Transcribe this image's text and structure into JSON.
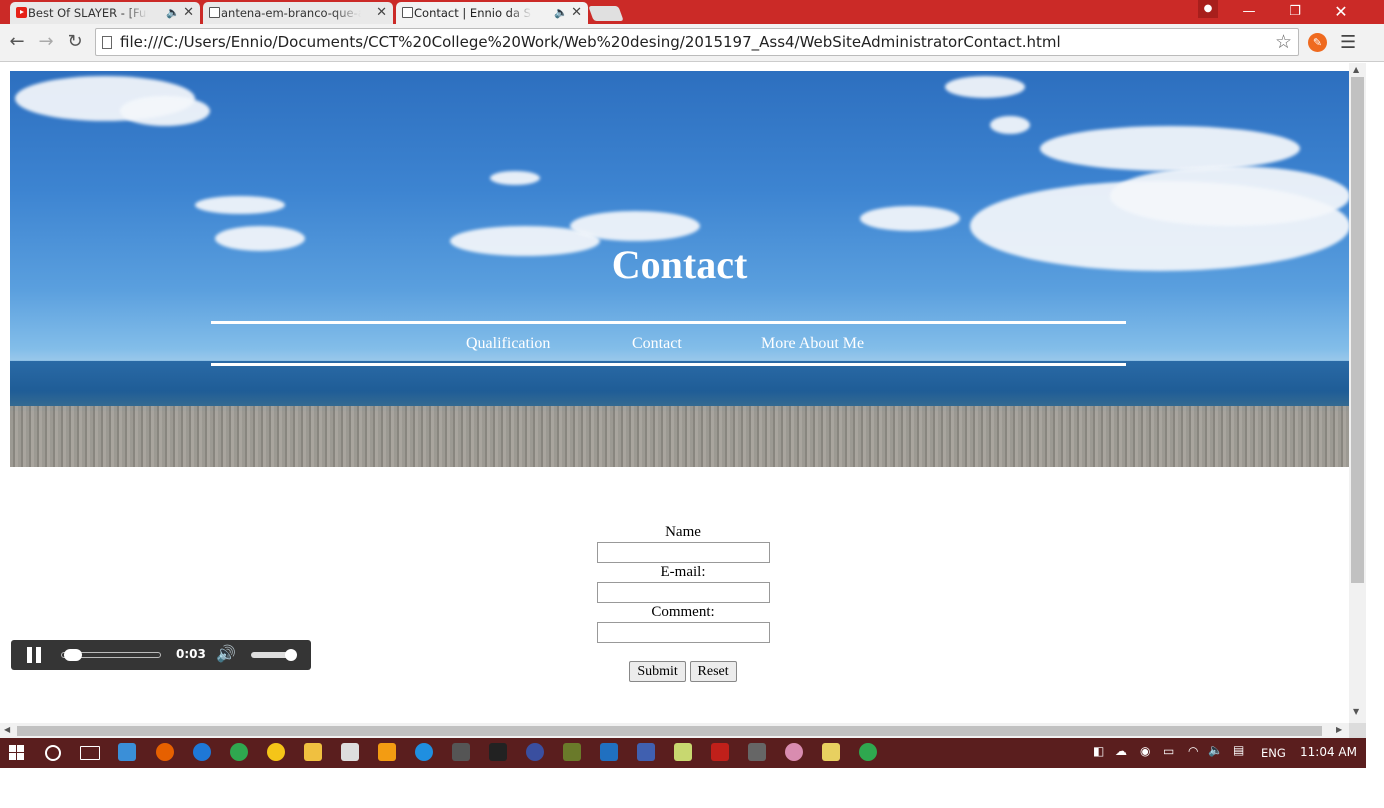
{
  "browser": {
    "tabs": [
      {
        "title": "Best Of SLAYER - [Full A",
        "favicon": "youtube-icon",
        "audio": true
      },
      {
        "title": "antena-em-branco-que-ap",
        "favicon": "page-icon",
        "audio": false
      },
      {
        "title": "Contact | Ennio da Silva",
        "favicon": "page-icon",
        "audio": true
      }
    ],
    "url": "file:///C:/Users/Ennio/Documents/CCT%20College%20Work/Web%20desing/2015197_Ass4/WebSiteAdministratorContact.html"
  },
  "page": {
    "header_title": "Contact",
    "nav": [
      "Qualification",
      "Contact",
      "More About Me"
    ],
    "form": {
      "name_label": "Name",
      "email_label": "E-mail:",
      "comment_label": "Comment:",
      "submit_label": "Submit",
      "reset_label": "Reset"
    }
  },
  "audio_player": {
    "time": "0:03",
    "progress": 0.03,
    "volume": 1.0
  },
  "taskbar": {
    "language": "ENG",
    "clock": "11:04 AM"
  },
  "colors": {
    "tabstrip": "#cb2a27",
    "taskbar": "#5a1e1e",
    "sky": "#3d84d1"
  }
}
